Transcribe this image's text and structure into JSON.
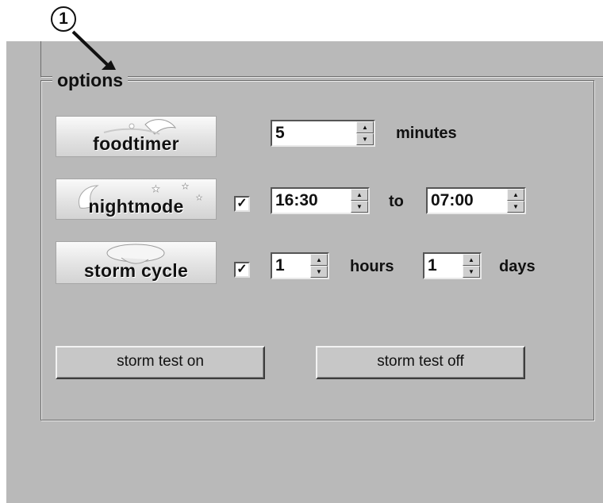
{
  "callout": {
    "number": "1"
  },
  "options": {
    "group_label": "options",
    "foodtimer": {
      "banner_label": "foodtimer",
      "value": "5",
      "unit_label": "minutes"
    },
    "nightmode": {
      "banner_label": "nightmode",
      "checked_glyph": "✓",
      "from_value": "16:30",
      "to_label": "to",
      "to_value": "07:00"
    },
    "storm_cycle": {
      "banner_label": "storm cycle",
      "checked_glyph": "✓",
      "hours_value": "1",
      "hours_label": "hours",
      "days_value": "1",
      "days_label": "days"
    }
  },
  "buttons": {
    "storm_test_on": "storm test on",
    "storm_test_off": "storm test off"
  },
  "icons": {
    "spin_up": "▲",
    "spin_down": "▼"
  }
}
